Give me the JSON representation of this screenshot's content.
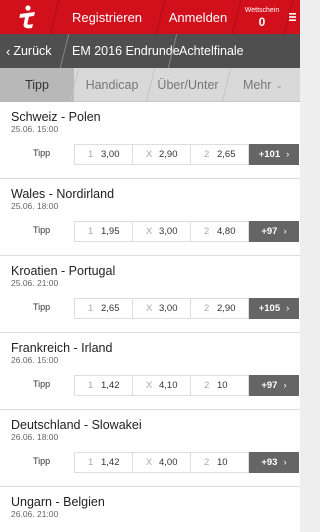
{
  "header": {
    "register_label": "Registrieren",
    "login_label": "Anmelden",
    "betslip_label": "Wettschein",
    "betslip_count": "0",
    "brand_color": "#d2101c"
  },
  "breadcrumb": {
    "back_label": "Zurück",
    "items": [
      "EM 2016 Endrunde",
      "Achtelfinale"
    ]
  },
  "tabs": [
    {
      "label": "Tipp",
      "active": true
    },
    {
      "label": "Handicap",
      "active": false
    },
    {
      "label": "Über/Unter",
      "active": false
    },
    {
      "label": "Mehr",
      "active": false
    }
  ],
  "matches": [
    {
      "teams": "Schweiz - Polen",
      "date": "25.06. 15:00",
      "bet_label": "Tipp",
      "odds": [
        {
          "key": "1",
          "value": "3,00"
        },
        {
          "key": "X",
          "value": "2,90"
        },
        {
          "key": "2",
          "value": "2,65"
        }
      ],
      "more": "+101"
    },
    {
      "teams": "Wales - Nordirland",
      "date": "25.06. 18:00",
      "bet_label": "Tipp",
      "odds": [
        {
          "key": "1",
          "value": "1,95"
        },
        {
          "key": "X",
          "value": "3,00"
        },
        {
          "key": "2",
          "value": "4,80"
        }
      ],
      "more": "+97"
    },
    {
      "teams": "Kroatien - Portugal",
      "date": "25.06. 21:00",
      "bet_label": "Tipp",
      "odds": [
        {
          "key": "1",
          "value": "2,65"
        },
        {
          "key": "X",
          "value": "3,00"
        },
        {
          "key": "2",
          "value": "2,90"
        }
      ],
      "more": "+105"
    },
    {
      "teams": "Frankreich - Irland",
      "date": "26.06. 15:00",
      "bet_label": "Tipp",
      "odds": [
        {
          "key": "1",
          "value": "1,42"
        },
        {
          "key": "X",
          "value": "4,10"
        },
        {
          "key": "2",
          "value": "10"
        }
      ],
      "more": "+97"
    },
    {
      "teams": "Deutschland - Slowakei",
      "date": "26.06. 18:00",
      "bet_label": "Tipp",
      "odds": [
        {
          "key": "1",
          "value": "1,42"
        },
        {
          "key": "X",
          "value": "4,00"
        },
        {
          "key": "2",
          "value": "10"
        }
      ],
      "more": "+93"
    },
    {
      "teams": "Ungarn - Belgien",
      "date": "26.06. 21:00"
    }
  ]
}
